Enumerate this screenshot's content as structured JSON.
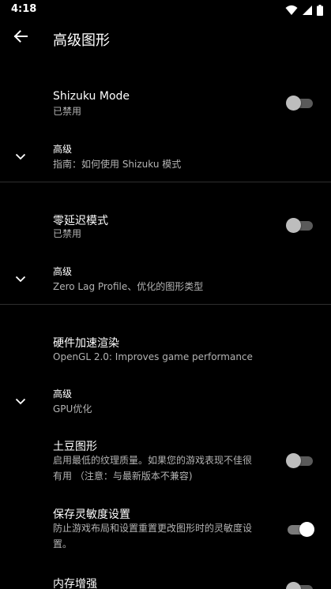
{
  "status_bar": {
    "time": "4:18",
    "icons": [
      "wifi-icon",
      "signal-icon",
      "battery-icon"
    ]
  },
  "app_bar": {
    "title": "高级图形",
    "back_icon": "arrow-left-icon"
  },
  "sections": {
    "shizuku": {
      "title": "Shizuku Mode",
      "summary": "已禁用",
      "switch_on": false,
      "advanced_title": "高级",
      "advanced_summary": "指南：如何使用 Shizuku 模式"
    },
    "zero_lag": {
      "title": "零延迟模式",
      "summary": "已禁用",
      "switch_on": false,
      "advanced_title": "高级",
      "advanced_summary": "Zero Lag Profile、优化的图形类型"
    },
    "hardware": {
      "title": "硬件加速渲染",
      "summary": "OpenGL 2.0: Improves game performance",
      "advanced_title": "高级",
      "advanced_summary": "GPU优化"
    },
    "potato": {
      "title": "土豆图形",
      "summary_line1": "启用最低的纹理质量。如果您的游戏表现不佳很",
      "summary_line2": "有用 （注意：与最新版本不兼容)",
      "switch_on": false
    },
    "save_sensitivity": {
      "title": "保存灵敏度设置",
      "summary_line1": "防止游戏布局和设置重置更改图形时的灵敏度设",
      "summary_line2": "置。",
      "switch_on": true
    },
    "memory_boost": {
      "title": "内存增强",
      "switch_on": false
    }
  },
  "colors": {
    "background": "#000000",
    "text_primary": "#ffffff",
    "text_secondary": "#b3b3b3",
    "divider": "#2e2e2e"
  }
}
